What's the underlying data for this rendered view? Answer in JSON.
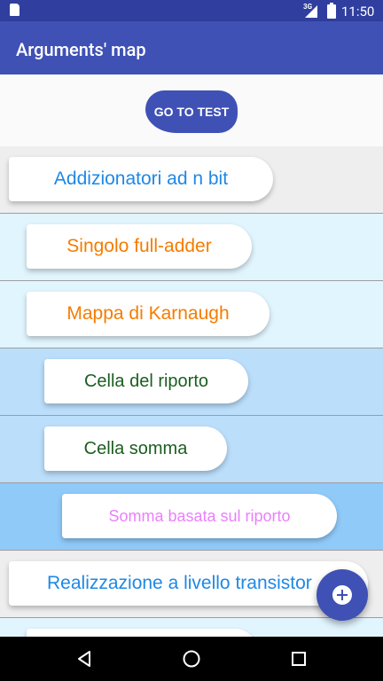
{
  "status_bar": {
    "network": "3G",
    "time": "11:50"
  },
  "app_bar": {
    "title": "Arguments' map"
  },
  "go_test_label": "GO TO TEST",
  "rows": [
    {
      "label": "Addizionatori ad n bit",
      "text_color": "#1e88e5",
      "bg": "#eeeeee"
    },
    {
      "label": "Singolo full-adder",
      "text_color": "#f57c00",
      "bg": "#e1f5fe"
    },
    {
      "label": "Mappa di Karnaugh",
      "text_color": "#f57c00",
      "bg": "#e1f5fe"
    },
    {
      "label": "Cella del riporto",
      "text_color": "#1b5e20",
      "bg": "#bbdefb"
    },
    {
      "label": "Cella somma",
      "text_color": "#1b5e20",
      "bg": "#bbdefb"
    },
    {
      "label": "Somma basata sul riporto",
      "text_color": "#ea80fc",
      "bg": "#90caf9"
    },
    {
      "label": "Realizzazione a livello transistor",
      "text_color": "#1e88e5",
      "bg": "#eeeeee"
    },
    {
      "label": "",
      "text_color": "#f57c00",
      "bg": "#e1f5fe"
    }
  ],
  "fab": {
    "icon": "add-circle-icon"
  },
  "nav_bar": {
    "icons": [
      "back-icon",
      "home-icon",
      "recents-icon"
    ]
  }
}
